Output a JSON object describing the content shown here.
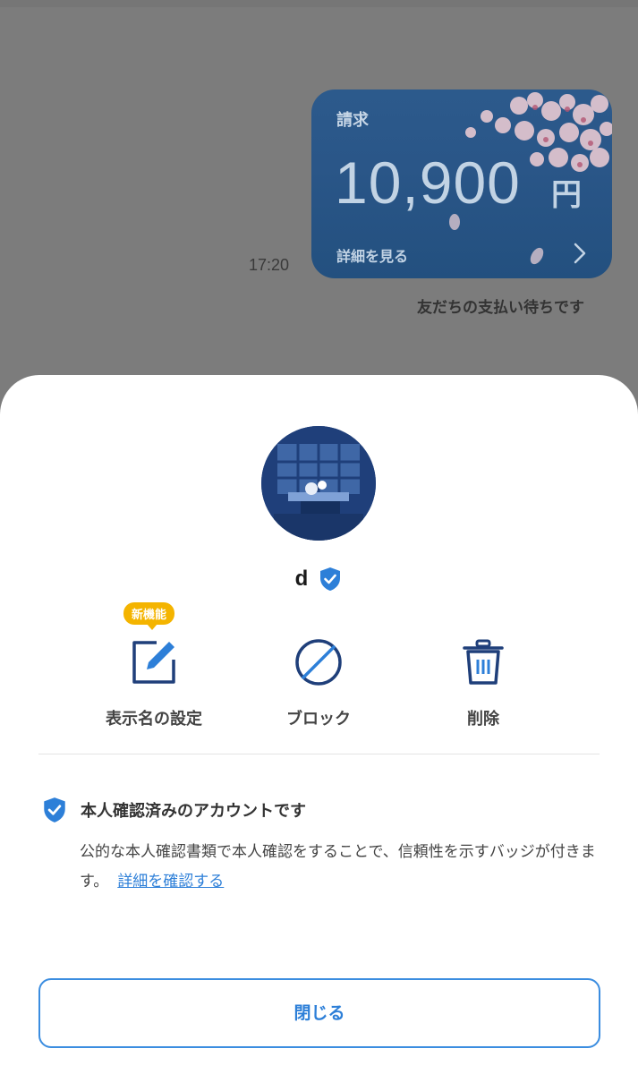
{
  "chat": {
    "timestamp": "17:20",
    "invoice": {
      "title": "請求",
      "amount": "10,900",
      "currency": "円",
      "link_label": "詳細を見る"
    },
    "status_text": "友だちの支払い待ちです"
  },
  "sheet": {
    "username": "d",
    "new_feature_badge": "新機能",
    "actions": [
      {
        "label": "表示名の設定",
        "icon": "edit-icon"
      },
      {
        "label": "ブロック",
        "icon": "block-icon"
      },
      {
        "label": "削除",
        "icon": "trash-icon"
      }
    ],
    "verified": {
      "title": "本人確認済みのアカウントです",
      "description": "公的な本人確認書類で本人確認をすることで、信頼性を示すバッジが付きます。",
      "link_label": "詳細を確認する"
    },
    "close_label": "閉じる"
  },
  "colors": {
    "accent": "#2d7fd8",
    "icon_dark": "#1f3f7a",
    "badge": "#f4b400",
    "card": "#2c5a8c"
  }
}
